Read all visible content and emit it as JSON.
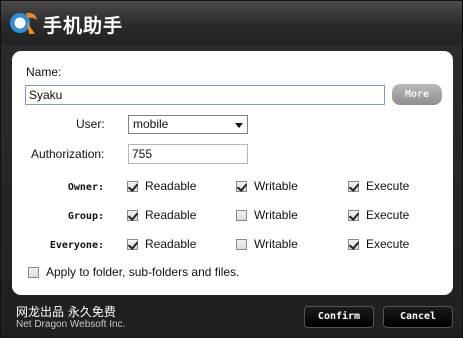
{
  "titlebar": {
    "app_title": "手机助手"
  },
  "form": {
    "name_label": "Name:",
    "name_value": "Syaku",
    "more_label": "More",
    "user_label": "User:",
    "user_value": "mobile",
    "auth_label": "Authorization:",
    "auth_value": "755"
  },
  "permissions": {
    "columns": [
      "Readable",
      "Writable",
      "Execute"
    ],
    "rows": [
      {
        "label": "Owner:",
        "checked": [
          true,
          true,
          true
        ]
      },
      {
        "label": "Group:",
        "checked": [
          true,
          false,
          true
        ]
      },
      {
        "label": "Everyone:",
        "checked": [
          true,
          false,
          true
        ]
      }
    ],
    "apply_label": "Apply to folder, sub-folders and files.",
    "apply_checked": false
  },
  "footer": {
    "tagline_cn": "网龙出品 永久免费",
    "company": "Net Dragon Websoft Inc.",
    "confirm_label": "Confirm",
    "cancel_label": "Cancel"
  },
  "colors": {
    "logo_blue": "#2f8fd6",
    "logo_orange": "#f08a1c"
  },
  "icons": {
    "logo": "logo-icon",
    "dropdown": "chevron-down-icon"
  }
}
